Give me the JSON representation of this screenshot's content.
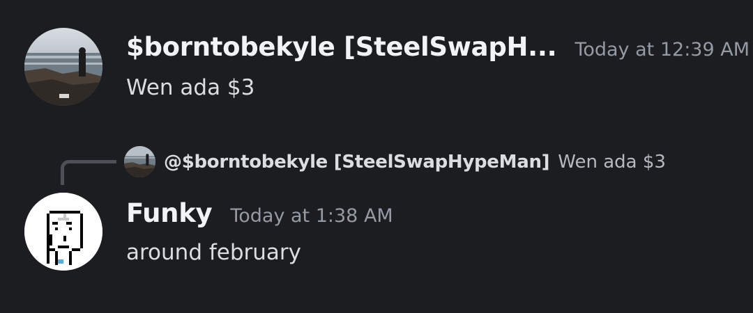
{
  "messages": [
    {
      "author": "$borntobekyle [SteelSwapH...",
      "timestamp": "Today at 12:39 AM",
      "content": "Wen ada $3",
      "avatar": "seaside-photo-avatar"
    },
    {
      "reply": {
        "author": "@$borntobekyle [SteelSwapHypeMan]",
        "content": "Wen ada $3",
        "avatar": "seaside-photo-avatar"
      },
      "author": "Funky",
      "timestamp": "Today at 1:38 AM",
      "content": "around february",
      "avatar": "pixel-punk-avatar"
    }
  ],
  "colors": {
    "background": "#1c1d21",
    "username": "#f2f3f5",
    "timestamp": "#949ba4",
    "message_text": "#dbdee1",
    "reply_line": "#4e5058"
  }
}
